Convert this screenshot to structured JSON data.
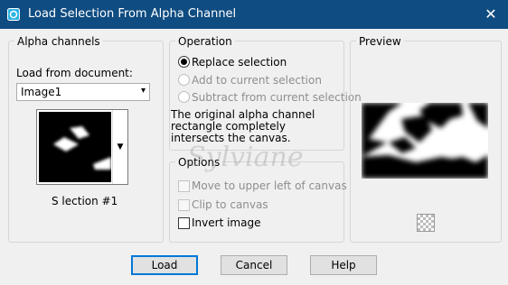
{
  "window": {
    "title": "Load Selection From Alpha Channel",
    "close_glyph": "✕",
    "titlebar_color": "#0f4c81"
  },
  "alpha": {
    "group_title": "Alpha channels",
    "load_from_label": "Load from document:",
    "document_value": "Image1",
    "selection_name": "S lection #1"
  },
  "operation": {
    "group_title": "Operation",
    "replace": "Replace selection",
    "add": "Add to current selection",
    "subtract": "Subtract from current selection",
    "info": "The original alpha channel rectangle completely intersects the canvas."
  },
  "options": {
    "group_title": "Options",
    "move": "Move to upper left of canvas",
    "clip": "Clip to canvas",
    "invert": "Invert image"
  },
  "preview": {
    "group_title": "Preview"
  },
  "watermark": "Sylviane",
  "buttons": {
    "load": "Load",
    "cancel": "Cancel",
    "help": "Help"
  },
  "icons": {
    "app": "app-icon",
    "dropdown": "chevron-down-icon",
    "checker": "transparency-checker-icon"
  }
}
